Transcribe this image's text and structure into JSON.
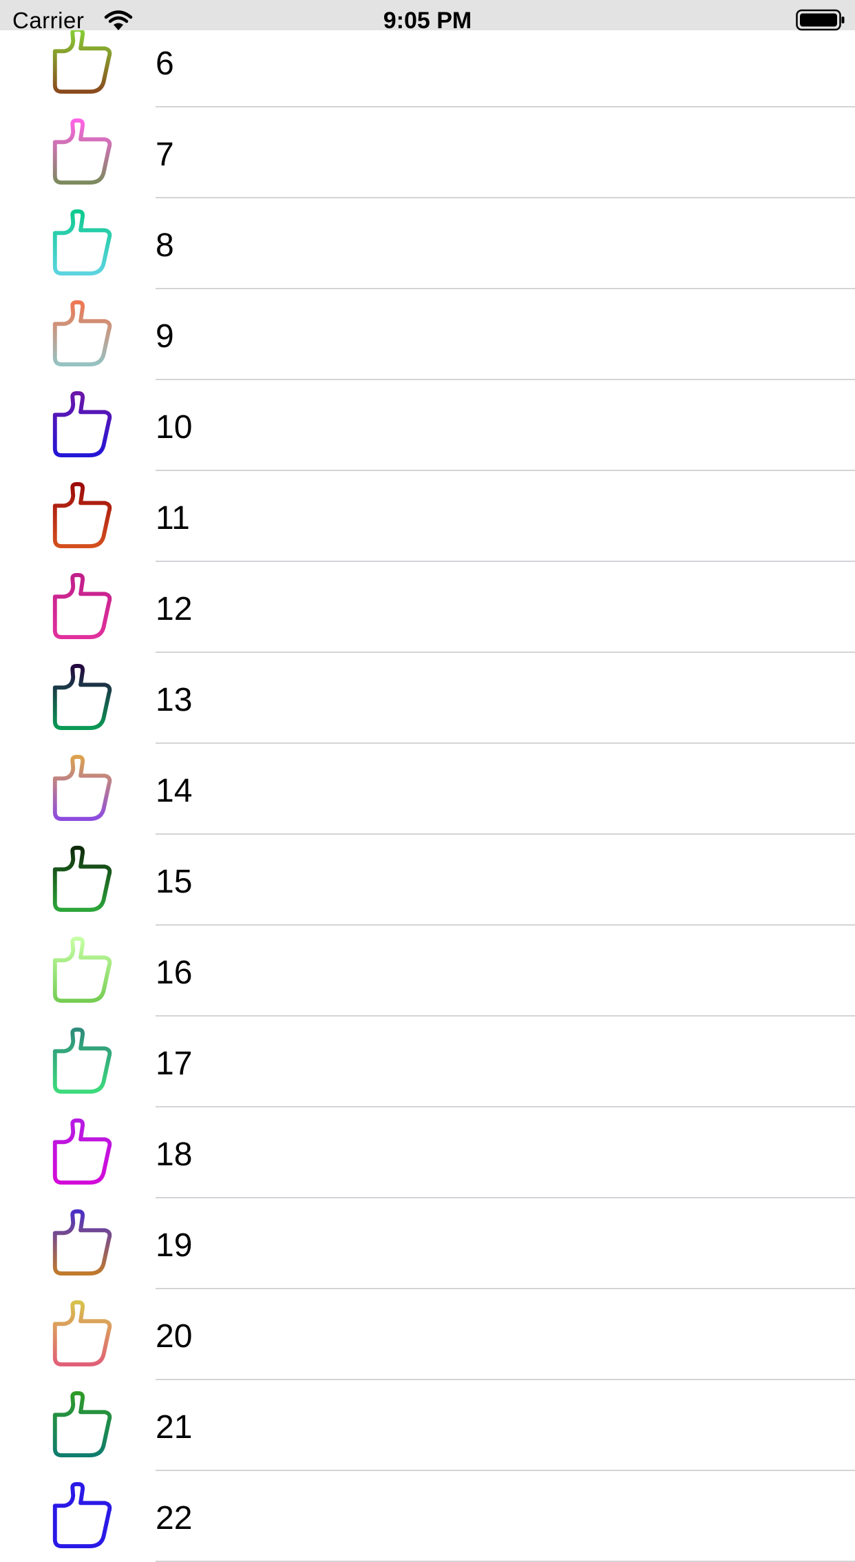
{
  "status_bar": {
    "carrier": "Carrier",
    "time": "9:05 PM"
  },
  "rows": [
    {
      "label": "",
      "top_color": "#ff6fd0",
      "bottom_color": "#ff6fd0",
      "icon": "thumbs-up-icon"
    },
    {
      "label": "6",
      "top_color": "#86d135",
      "bottom_color": "#8a4a1e",
      "icon": "thumbs-up-icon"
    },
    {
      "label": "7",
      "top_color": "#ff63e6",
      "bottom_color": "#7c8a5e",
      "icon": "thumbs-up-icon"
    },
    {
      "label": "8",
      "top_color": "#0fca8f",
      "bottom_color": "#5cd4e0",
      "icon": "thumbs-up-icon"
    },
    {
      "label": "9",
      "top_color": "#ef7752",
      "bottom_color": "#95c2c2",
      "icon": "thumbs-up-icon"
    },
    {
      "label": "10",
      "top_color": "#6c16a8",
      "bottom_color": "#2416d6",
      "icon": "thumbs-up-icon"
    },
    {
      "label": "11",
      "top_color": "#9b0a0a",
      "bottom_color": "#d44f1e",
      "icon": "thumbs-up-icon"
    },
    {
      "label": "12",
      "top_color": "#c01f8a",
      "bottom_color": "#e0309c",
      "icon": "thumbs-up-icon"
    },
    {
      "label": "13",
      "top_color": "#24063f",
      "bottom_color": "#0a9a55",
      "icon": "thumbs-up-icon"
    },
    {
      "label": "14",
      "top_color": "#dca34e",
      "bottom_color": "#8d4ce0",
      "icon": "thumbs-up-icon"
    },
    {
      "label": "15",
      "top_color": "#0e2a0a",
      "bottom_color": "#2da63a",
      "icon": "thumbs-up-icon"
    },
    {
      "label": "16",
      "top_color": "#c7ffa6",
      "bottom_color": "#76cd53",
      "icon": "thumbs-up-icon"
    },
    {
      "label": "17",
      "top_color": "#2e8b7b",
      "bottom_color": "#3ddb7c",
      "icon": "thumbs-up-icon"
    },
    {
      "label": "18",
      "top_color": "#b61be3",
      "bottom_color": "#d30ad8",
      "icon": "thumbs-up-icon"
    },
    {
      "label": "19",
      "top_color": "#4b2fc6",
      "bottom_color": "#c07a2c",
      "icon": "thumbs-up-icon"
    },
    {
      "label": "20",
      "top_color": "#d8c24d",
      "bottom_color": "#e06077",
      "icon": "thumbs-up-icon"
    },
    {
      "label": "21",
      "top_color": "#2f9a28",
      "bottom_color": "#0f7d6e",
      "icon": "thumbs-up-icon"
    },
    {
      "label": "22",
      "top_color": "#2a19e6",
      "bottom_color": "#2a19e6",
      "icon": "thumbs-up-icon"
    }
  ]
}
